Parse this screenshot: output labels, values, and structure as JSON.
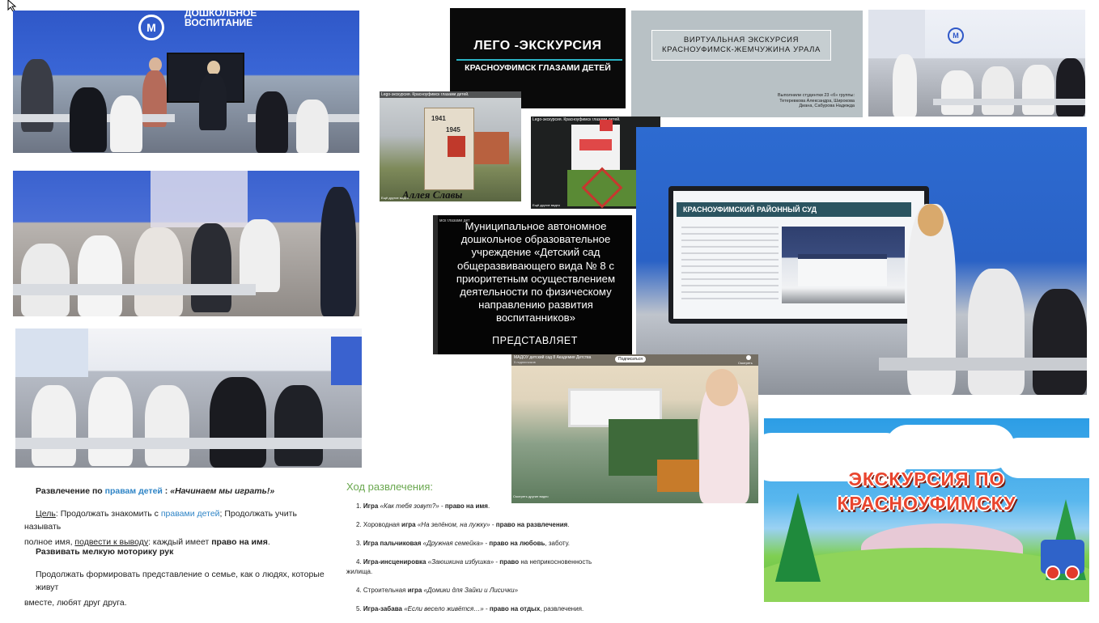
{
  "photos": {
    "top_left_wall_sign_line1": "ДОШКОЛЬНОЕ",
    "top_left_wall_sign_line2": "ВОСПИТАНИЕ",
    "top_left_logo_letter": "М"
  },
  "lego_slide": {
    "title": "ЛЕГО -ЭКСКУРСИЯ",
    "subtitle": "КРАСНОУФИМСК ГЛАЗАМИ ДЕТЕЙ"
  },
  "virtual_slide": {
    "title_line1": "ВИРТУАЛЬНАЯ ЭКСКУРСИЯ",
    "title_line2": "КРАСНОУФИМСК-ЖЕМЧУЖИНА УРАЛА",
    "credits_line1": "Выполнили студентки 23 «б» группы:",
    "credits_line2": "Тетеревкова Александра, Широкова",
    "credits_line3": "Диана, Сабурова Надежда"
  },
  "video_thumb1": {
    "caption": "Lego-экскурсия. Красноуфимск глазами детей.",
    "monument_year1": "1941",
    "monument_year2": "1945",
    "alley_sign": "Аллея Славы",
    "footer": "Ещё другие видео"
  },
  "video_thumb2": {
    "caption": "Lego-экскурсия. Красноуфимск глазами детей.",
    "footer": "Ещё другие видео"
  },
  "institution_slide": {
    "top_caption": "мск глазами дет",
    "text": "Муниципальное автономное дошкольное образовательное учреждение «Детский сад общеразвивающего вида № 8 с приоритетным осуществлением деятельности по физическому направлению развития воспитанников»",
    "presents": "ПРЕДСТАВЛЯЕТ"
  },
  "court_slide": {
    "title": "КРАСНОУФИМСКИЙ РАЙОННЫЙ СУД"
  },
  "video_kindergarten": {
    "channel": "МАДОУ детский сад 8 Академия Детства",
    "subs": "5 подписчиков",
    "subscribe": "Подписаться",
    "share": "Смотреть",
    "footer": "Смотреть другие видео"
  },
  "excursion_banner": {
    "line1": "ЭКСКУРСИЯ ПО",
    "line2": "КРАСНОУФИМСКУ"
  },
  "doc": {
    "heading_prefix": "Развлечение по ",
    "heading_link": "правам детей",
    "heading_sep": " : ",
    "heading_quote": "«Начинаем мы играть!»",
    "goal_label": "Цель",
    "goal_text1": ": Продолжать знакомить с ",
    "goal_link": "правами детей",
    "goal_text2": "; Продолжать учить называть",
    "goal_text3": "полное имя, ",
    "goal_underlined": "подвести к выводу",
    "goal_text4": ": каждый имеет ",
    "goal_bold": "право на имя",
    "goal_end": ".",
    "motor": "Развивать мелкую моторику рук",
    "family1": "Продолжать формировать представление о семье, как о людях, которые живут",
    "family2": "вместе, любят друг друга."
  },
  "course": {
    "title": "Ход развлечения:",
    "steps": [
      {
        "num": "1.",
        "pre": "Игра ",
        "game": "«Как тебя зовут?»",
        "mid": " - ",
        "right": "право на имя",
        "post": "."
      },
      {
        "num": "2.",
        "pre": "Хороводная ",
        "pre_bold": "игра",
        "game": " «На зелёном, на лужку»",
        "mid": " - ",
        "right": "право на развлечения",
        "post": "."
      },
      {
        "num": "3.",
        "pre": "Игра пальчиковая ",
        "game": "«Дружная семейка»",
        "mid": " - ",
        "right": "право на любовь",
        "post": ", заботу."
      },
      {
        "num": "4.",
        "pre": "Игра-инсценировка ",
        "game": "«Заюшкина избушка»",
        "mid": " - ",
        "right": "право",
        "post": " на неприкосновенность"
      },
      {
        "num": "",
        "pre": "жилища.",
        "game": "",
        "mid": "",
        "right": "",
        "post": ""
      },
      {
        "num": "4.",
        "pre": "Строительная ",
        "pre_bold": "игра",
        "game": " «Домики для Зайки и Лисички»",
        "mid": "",
        "right": "",
        "post": ""
      },
      {
        "num": "5.",
        "pre": "Игра-забава ",
        "game": "«Если весело живётся…»",
        "mid": " - ",
        "right": "право на отдых",
        "post": ", развлечения."
      }
    ]
  },
  "colors": {
    "accent_blue": "#2e84c6",
    "course_title_green": "#6aa84f",
    "wall_blue": "#2f58c8"
  }
}
